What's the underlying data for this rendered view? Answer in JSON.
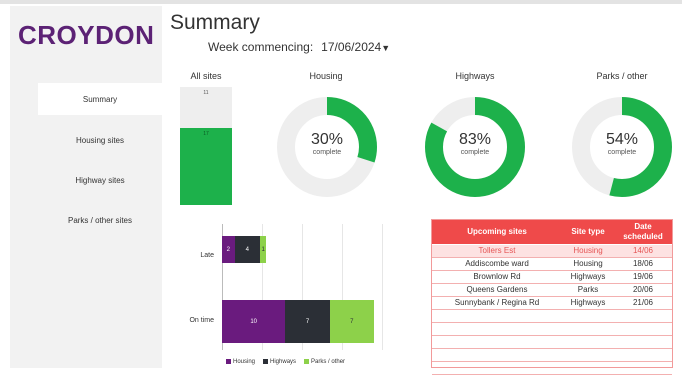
{
  "brand": {
    "logo_text": "CROYDON"
  },
  "sidebar": {
    "items": [
      {
        "label": "Summary",
        "active": true
      },
      {
        "label": "Housing sites"
      },
      {
        "label": "Highway sites"
      },
      {
        "label": "Parks / other sites"
      }
    ]
  },
  "header": {
    "title": "Summary",
    "week_label": "Week commencing:",
    "week_value": "17/06/2024"
  },
  "kpis": {
    "all_sites": {
      "label": "All sites",
      "top_value": "11",
      "bottom_value": "17",
      "fill_fraction": 0.65
    },
    "housing": {
      "label": "Housing",
      "percent": 30,
      "percent_text": "30%",
      "sub": "complete"
    },
    "highways": {
      "label": "Highways",
      "percent": 83,
      "percent_text": "83%",
      "sub": "complete"
    },
    "parks": {
      "label": "Parks / other",
      "percent": 54,
      "percent_text": "54%",
      "sub": "complete"
    },
    "colors": {
      "fill": "#1db14b",
      "track": "#eeeeee"
    }
  },
  "chart_data": {
    "type": "bar",
    "orientation": "horizontal",
    "stacked": true,
    "categories": [
      "Late",
      "On time"
    ],
    "series": [
      {
        "name": "Housing",
        "values": [
          2,
          10
        ],
        "color": "#6a1b7e"
      },
      {
        "name": "Highways",
        "values": [
          4,
          7
        ],
        "color": "#2b2f36"
      },
      {
        "name": "Parks / other",
        "values": [
          1,
          7
        ],
        "color": "#8dd14a"
      }
    ],
    "xlim": [
      0,
      30
    ],
    "grid": true,
    "legend": "bottom"
  },
  "upcoming": {
    "headers": {
      "site": "Upcoming sites",
      "type": "Site type",
      "date": "Date scheduled"
    },
    "rows": [
      {
        "site": "Tollers Est",
        "type": "Housing",
        "date": "14/06",
        "highlight": true
      },
      {
        "site": "Addiscombe ward",
        "type": "Housing",
        "date": "18/06"
      },
      {
        "site": "Brownlow Rd",
        "type": "Highways",
        "date": "19/06"
      },
      {
        "site": "Queens Gardens",
        "type": "Parks",
        "date": "20/06"
      },
      {
        "site": "Sunnybank / Regina Rd",
        "type": "Highways",
        "date": "21/06"
      }
    ],
    "empty_rows": 5
  }
}
